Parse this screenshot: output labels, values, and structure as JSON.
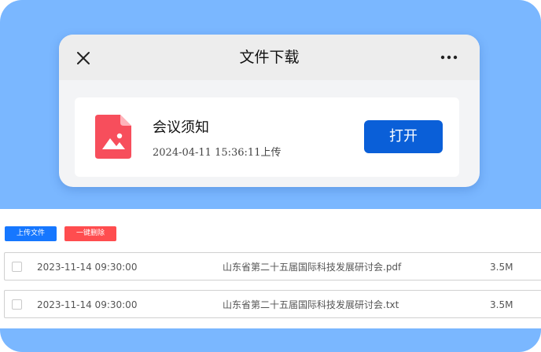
{
  "dialog": {
    "title": "文件下载",
    "close_icon": "close-icon",
    "more_icon": "more-icon",
    "file": {
      "name": "会议须知",
      "meta": "2024-04-11 15:36:11上传",
      "icon": "image-file-icon",
      "icon_color": "#f74e5c"
    },
    "open_label": "打开",
    "open_color": "#0a5fd8"
  },
  "toolbar": {
    "upload_label": "上传文件",
    "upload_color": "#1677ff",
    "delete_label": "一键删除",
    "delete_color": "#ff4d4f"
  },
  "files": [
    {
      "date": "2023-11-14 09:30:00",
      "name": "山东省第二十五届国际科技发展研讨会.pdf",
      "size": "3.5M"
    },
    {
      "date": "2023-11-14 09:30:00",
      "name": "山东省第二十五届国际科技发展研讨会.txt",
      "size": "3.5M"
    }
  ],
  "colors": {
    "background": "#7ab7ff"
  }
}
